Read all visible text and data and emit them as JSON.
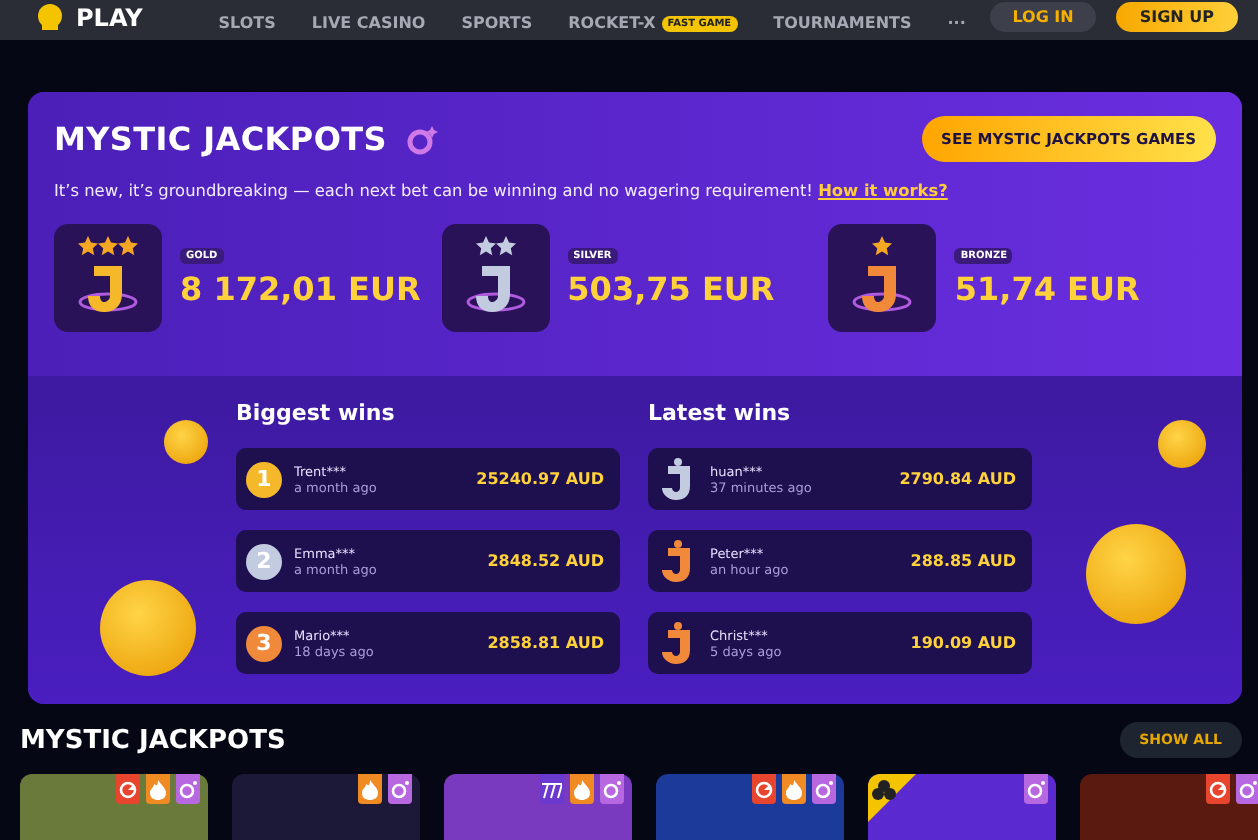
{
  "header": {
    "logo": "PLAY",
    "nav": [
      {
        "label": "SLOTS"
      },
      {
        "label": "LIVE CASINO"
      },
      {
        "label": "SPORTS"
      },
      {
        "label": "ROCKET-X",
        "badge": "FAST GAME"
      },
      {
        "label": "TOURNAMENTS"
      },
      {
        "label": "···"
      }
    ],
    "login": "LOG IN",
    "signup": "SIGN UP"
  },
  "promo": {
    "title": "MYSTIC JACKPOTS",
    "button": "SEE MYSTIC JACKPOTS GAMES",
    "tagline": "It’s new, it’s groundbreaking — each next bet can be winning and no wagering requirement!",
    "link": "How it works?",
    "jackpots": [
      {
        "kind": "gold",
        "label": "GOLD",
        "amount": "8 172,01 EUR"
      },
      {
        "kind": "silver",
        "label": "SILVER",
        "amount": "503,75 EUR"
      },
      {
        "kind": "bronze",
        "label": "BRONZE",
        "amount": "51,74 EUR"
      }
    ],
    "biggest_wins": {
      "title": "Biggest wins",
      "rows": [
        {
          "kind": "gold",
          "rank": "1",
          "user": "Trent***",
          "time": "a month ago",
          "amount": "25240.97 AUD"
        },
        {
          "kind": "silver",
          "rank": "2",
          "user": "Emma***",
          "time": "a month ago",
          "amount": "2848.52 AUD"
        },
        {
          "kind": "bronze",
          "rank": "3",
          "user": "Mario***",
          "time": "18 days ago",
          "amount": "2858.81 AUD"
        }
      ]
    },
    "latest_wins": {
      "title": "Latest wins",
      "rows": [
        {
          "kind": "silver",
          "user": "huan***",
          "time": "37 minutes ago",
          "amount": "2790.84 AUD"
        },
        {
          "kind": "bronze",
          "user": "Peter***",
          "time": "an hour ago",
          "amount": "288.85 AUD"
        },
        {
          "kind": "bronze",
          "user": "Christ***",
          "time": "5 days ago",
          "amount": "190.09 AUD"
        }
      ]
    }
  },
  "games": {
    "title": "MYSTIC JACKPOTS",
    "show_all": "SHOW ALL",
    "tiles": [
      {
        "tags": [
          {
            "kind": "cashback"
          },
          {
            "kind": "hot"
          },
          {
            "kind": "jackpot"
          }
        ]
      },
      {
        "tags": [
          {
            "kind": "hot"
          },
          {
            "kind": "jackpot"
          }
        ]
      },
      {
        "tags": [
          {
            "kind": "sevens"
          },
          {
            "kind": "hot"
          },
          {
            "kind": "jackpot"
          }
        ]
      },
      {
        "tags": [
          {
            "kind": "cashback"
          },
          {
            "kind": "hot"
          },
          {
            "kind": "jackpot"
          }
        ]
      },
      {
        "tags": [
          {
            "kind": "club"
          },
          {
            "kind": "jackpot"
          }
        ]
      },
      {
        "tags": [
          {
            "kind": "cashback"
          },
          {
            "kind": "jackpot"
          }
        ]
      }
    ]
  }
}
